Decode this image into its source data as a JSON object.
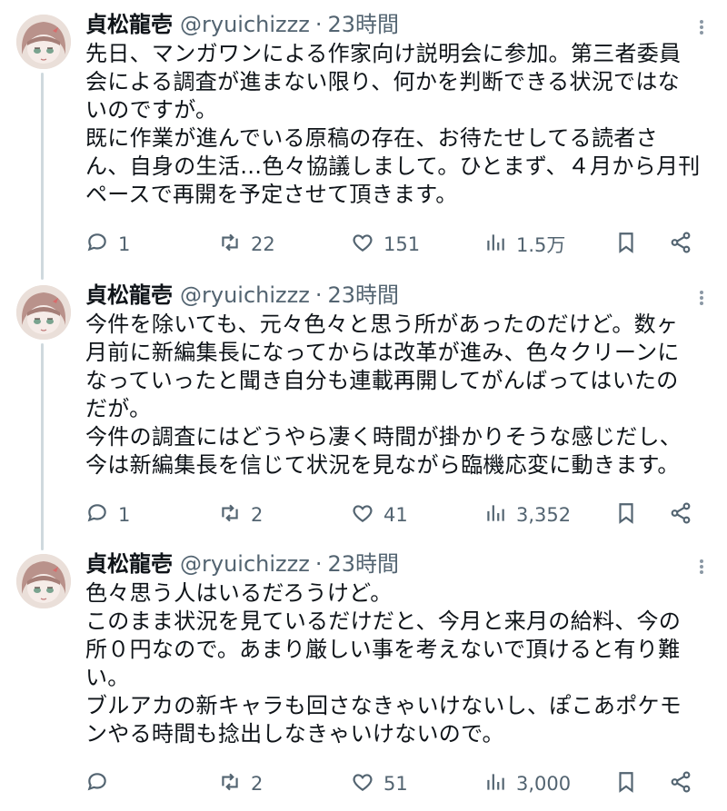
{
  "tweets": [
    {
      "name": "貞松龍壱",
      "handle": "@ryuichizzz",
      "separator": "·",
      "time": "23時間",
      "text": "先日、マンガワンによる作家向け説明会に参加。第三者委員\n会による調査が進まない限り、何かを判断できる状況ではな\nいのですが。\n既に作業が進んでいる原稿の存在、お待たせしてる読者さ\nん、自身の生活…色々協議しまして。ひとまず、４月から月刊\nペースで再開を予定させて頂きます。",
      "replies": "1",
      "retweets": "22",
      "likes": "151",
      "views": "1.5万"
    },
    {
      "name": "貞松龍壱",
      "handle": "@ryuichizzz",
      "separator": "·",
      "time": "23時間",
      "text": "今件を除いても、元々色々と思う所があったのだけど。数ヶ\n月前に新編集長になってからは改革が進み、色々クリーンに\nなっていったと聞き自分も連載再開してがんばってはいたの\nだが。\n今件の調査にはどうやら凄く時間が掛かりそうな感じだし、\n今は新編集長を信じて状況を見ながら臨機応変に動きます。",
      "replies": "1",
      "retweets": "2",
      "likes": "41",
      "views": "3,352"
    },
    {
      "name": "貞松龍壱",
      "handle": "@ryuichizzz",
      "separator": "·",
      "time": "23時間",
      "text": "色々思う人はいるだろうけど。\nこのまま状況を見ているだけだと、今月と来月の給料、今の\n所０円なので。あまり厳しい事を考えないで頂けると有り難\nい。\nブルアカの新キャラも回さなきゃいけないし、ぽこあポケモ\nンやる時間も捻出しなきゃいけないので。",
      "replies": "",
      "retweets": "2",
      "likes": "51",
      "views": "3,000"
    }
  ],
  "icons": {
    "reply": "reply-icon",
    "retweet": "retweet-icon",
    "like": "heart-icon",
    "views": "views-icon",
    "bookmark": "bookmark-icon",
    "share": "share-icon",
    "more": "more-icon"
  },
  "colors": {
    "text": "#0f1419",
    "secondary": "#536471",
    "thread_line": "#cfd9de"
  }
}
